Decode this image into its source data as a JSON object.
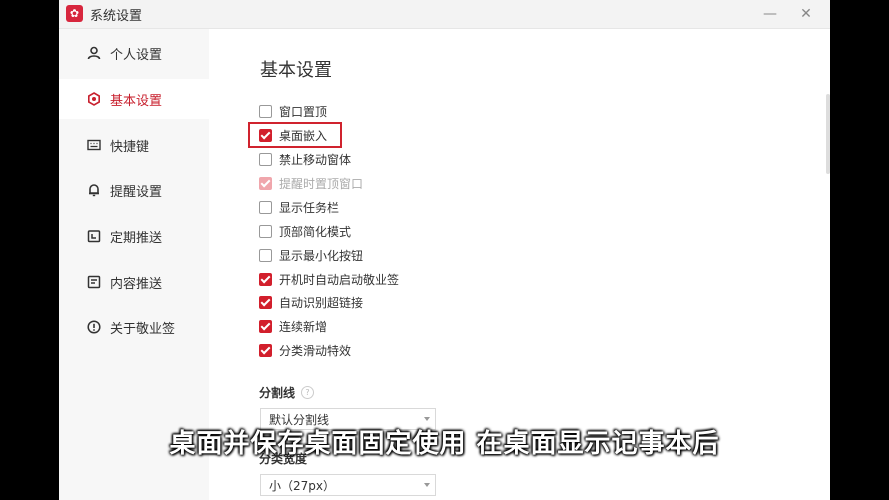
{
  "window": {
    "title": "系统设置",
    "app_icon_glyph": "✿",
    "minimize": "—",
    "close": "✕"
  },
  "sidebar": {
    "items": [
      {
        "label": "个人设置",
        "icon": "person-icon",
        "active": false
      },
      {
        "label": "基本设置",
        "icon": "settings-icon",
        "active": true
      },
      {
        "label": "快捷键",
        "icon": "keyboard-icon",
        "active": false
      },
      {
        "label": "提醒设置",
        "icon": "bell-icon",
        "active": false
      },
      {
        "label": "定期推送",
        "icon": "calendar-icon",
        "active": false
      },
      {
        "label": "内容推送",
        "icon": "document-icon",
        "active": false
      },
      {
        "label": "关于敬业签",
        "icon": "info-icon",
        "active": false
      }
    ]
  },
  "main": {
    "heading": "基本设置",
    "options": [
      {
        "label": "窗口置顶",
        "checked": false,
        "disabled": false
      },
      {
        "label": "桌面嵌入",
        "checked": true,
        "disabled": false,
        "highlighted": true
      },
      {
        "label": "禁止移动窗体",
        "checked": false,
        "disabled": false
      },
      {
        "label": "提醒时置顶窗口",
        "checked": true,
        "disabled": true
      },
      {
        "label": "显示任务栏",
        "checked": false,
        "disabled": false
      },
      {
        "label": "顶部简化模式",
        "checked": false,
        "disabled": false
      },
      {
        "label": "显示最小化按钮",
        "checked": false,
        "disabled": false
      },
      {
        "label": "开机时自动启动敬业签",
        "checked": true,
        "disabled": false
      },
      {
        "label": "自动识别超链接",
        "checked": true,
        "disabled": false
      },
      {
        "label": "连续新增",
        "checked": true,
        "disabled": false
      },
      {
        "label": "分类滑动特效",
        "checked": true,
        "disabled": false
      }
    ],
    "divider_section": {
      "label": "分割线",
      "help": "?",
      "value": "默认分割线"
    },
    "width_section": {
      "label": "分类宽度",
      "value": "小（27px）"
    }
  },
  "caption": "桌面并保存桌面固定使用 在桌面显示记事本后",
  "colors": {
    "accent": "#d21f2c",
    "sidebar_bg": "#f7f7f7"
  }
}
